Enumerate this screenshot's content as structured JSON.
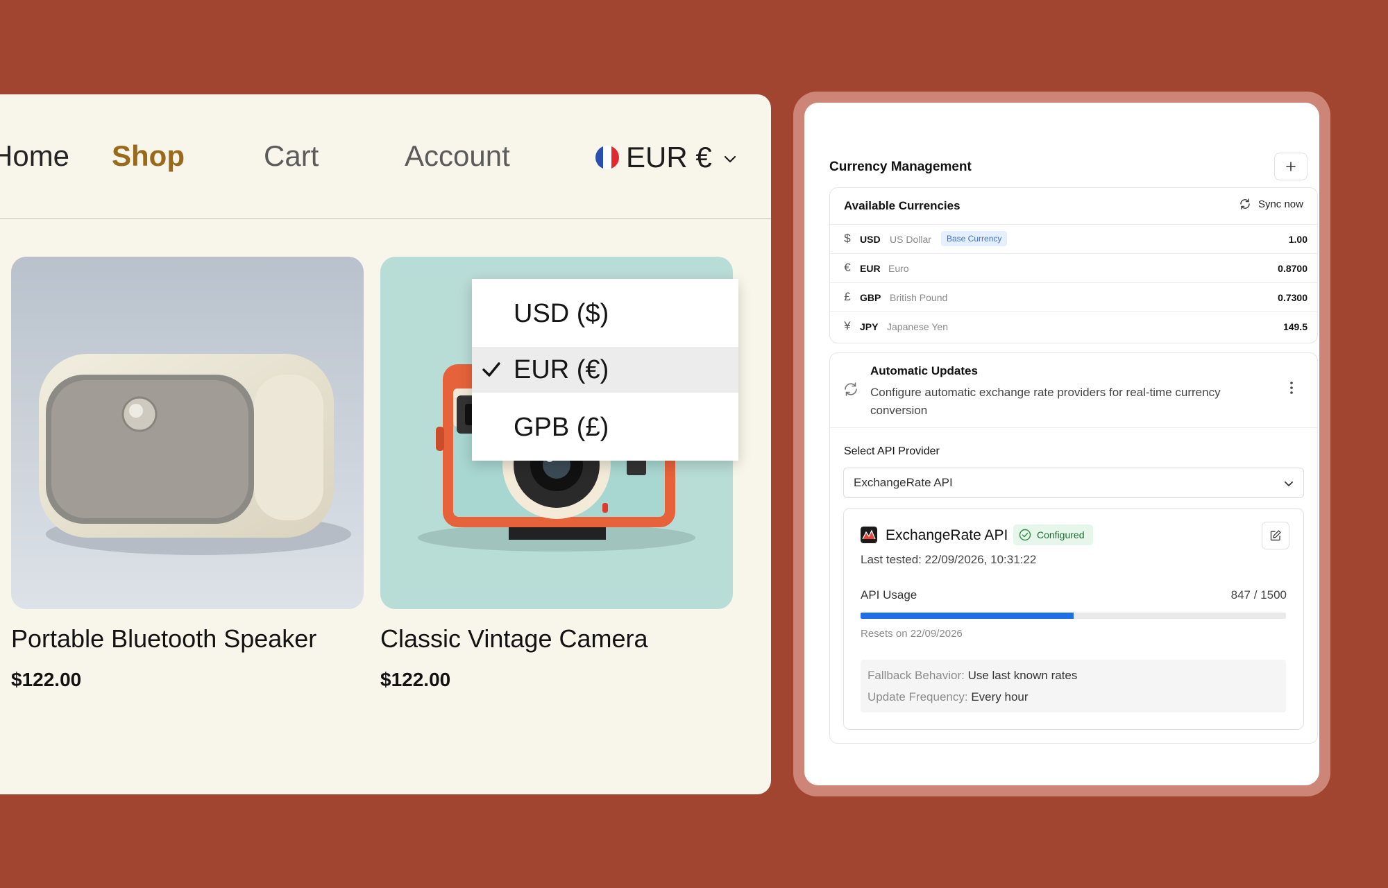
{
  "shop": {
    "nav": {
      "home": "Home",
      "shop": "Shop",
      "cart": "Cart",
      "account": "Account"
    },
    "currency_selector": {
      "label": "EUR €",
      "flag": "france-flag"
    },
    "currency_dropdown": {
      "options": [
        {
          "label": "USD ($)",
          "selected": false
        },
        {
          "label": "EUR (€)",
          "selected": true
        },
        {
          "label": "GPB (£)",
          "selected": false
        }
      ]
    },
    "products": [
      {
        "name": "Portable Bluetooth Speaker",
        "price": "$122.00"
      },
      {
        "name": "Classic Vintage Camera",
        "price": "$122.00"
      }
    ]
  },
  "admin": {
    "title": "Currency Management",
    "available_currencies": {
      "title": "Available Currencies",
      "sync_label": "Sync now",
      "rows": [
        {
          "symbol": "$",
          "code": "USD",
          "name": "US Dollar",
          "badge": "Base Currency",
          "rate": "1.00"
        },
        {
          "symbol": "€",
          "code": "EUR",
          "name": "Euro",
          "rate": "0.8700"
        },
        {
          "symbol": "£",
          "code": "GBP",
          "name": "British Pound",
          "rate": "0.7300"
        },
        {
          "symbol": "¥",
          "code": "JPY",
          "name": "Japanese Yen",
          "rate": "149.5"
        }
      ]
    },
    "automatic_updates": {
      "title": "Automatic Updates",
      "description": "Configure automatic exchange rate providers for real-time currency conversion",
      "select_label": "Select API Provider",
      "selected_provider": "ExchangeRate API",
      "provider": {
        "name": "ExchangeRate API",
        "status": "Configured",
        "last_tested": "Last tested: 22/09/2026, 10:31:22",
        "usage_label": "API Usage",
        "usage_value": "847 / 1500",
        "usage_fraction": 0.5,
        "resets": "Resets on 22/09/2026",
        "fallback_key": "Fallback Behavior:",
        "fallback_value": "Use last known rates",
        "frequency_key": "Update Frequency:",
        "frequency_value": "Every hour"
      }
    }
  },
  "colors": {
    "background": "#a14531",
    "accent_nav": "#9a6a1c",
    "progress": "#1e6ee6",
    "badge_base_bg": "#e4efff",
    "badge_configured_bg": "#e6f6ea"
  }
}
